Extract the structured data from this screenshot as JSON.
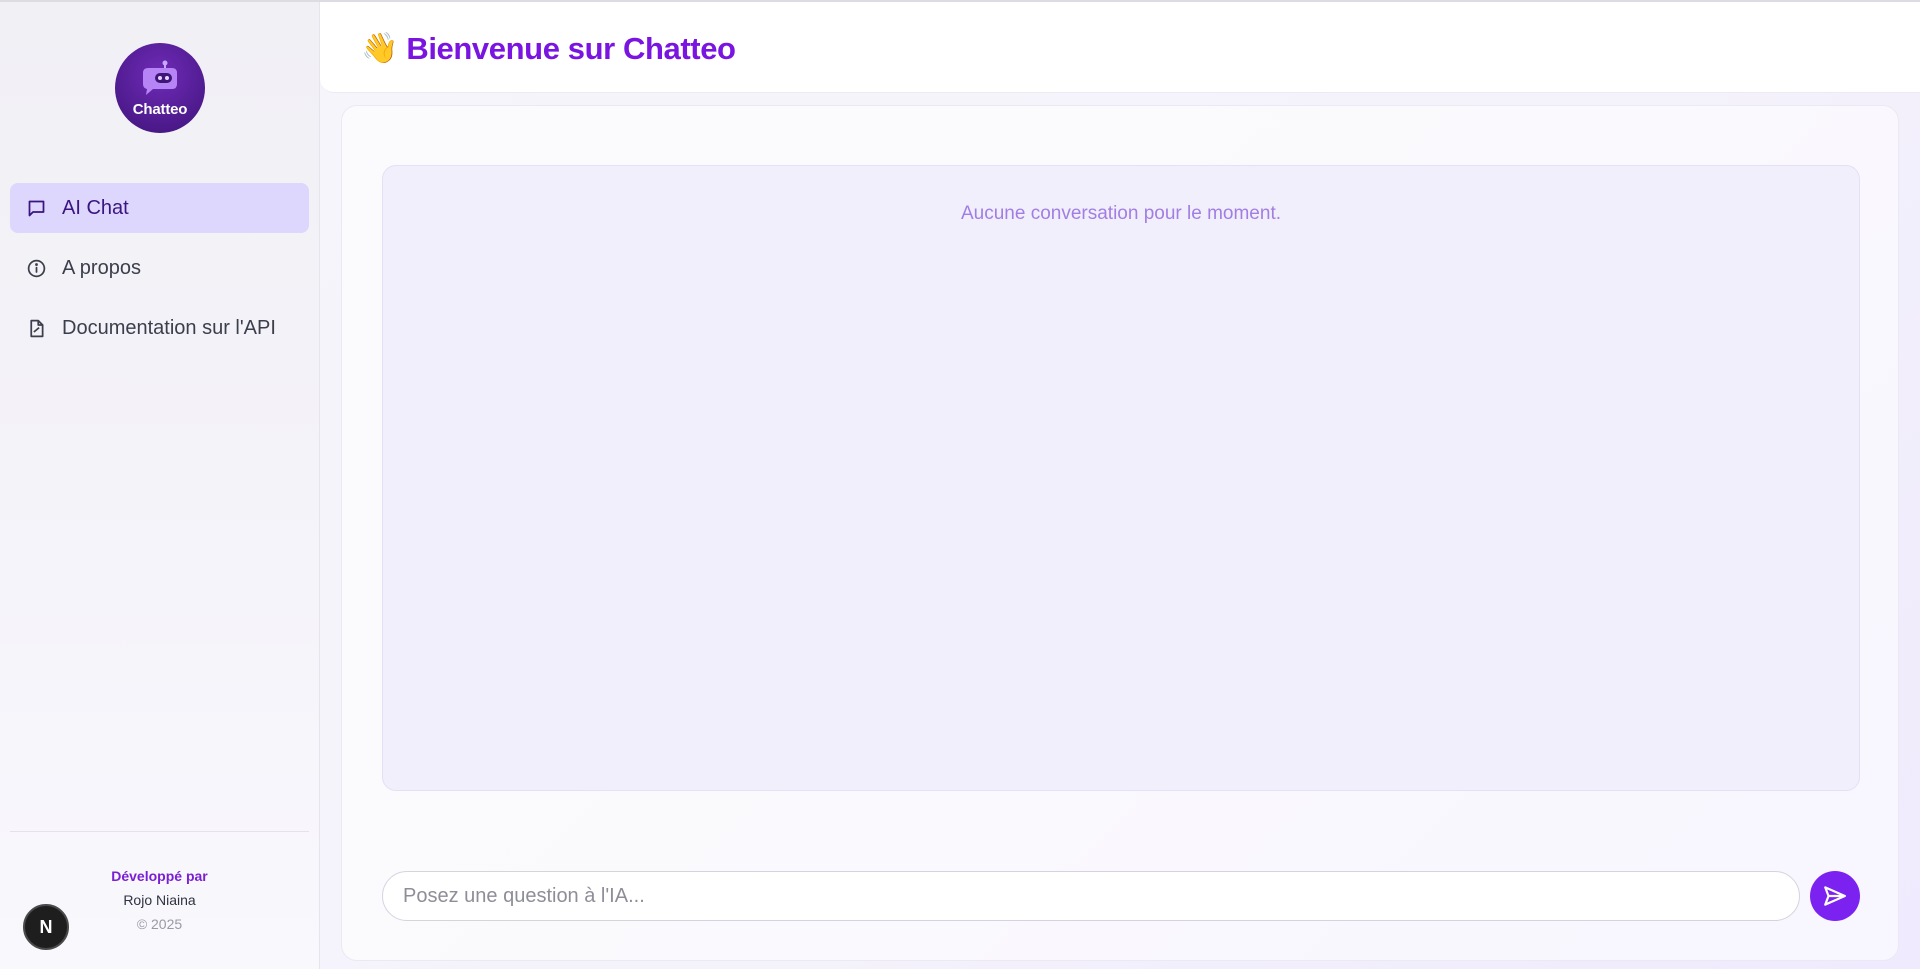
{
  "header": {
    "wave_emoji": "👋",
    "title": "Bienvenue sur Chatteo"
  },
  "sidebar": {
    "logo_text": "Chatteo",
    "items": [
      {
        "label": "AI Chat",
        "icon": "chat-bubble-icon",
        "active": true
      },
      {
        "label": "A propos",
        "icon": "info-icon",
        "active": false
      },
      {
        "label": "Documentation sur l'API",
        "icon": "document-icon",
        "active": false
      }
    ],
    "credit": {
      "developed_by": "Développé par",
      "name": "Rojo Niaina",
      "copyright": "© 2025"
    },
    "badge_letter": "N"
  },
  "chat": {
    "empty_message": "Aucune conversation pour le moment.",
    "input_placeholder": "Posez une question à l'IA...",
    "input_value": ""
  },
  "colors": {
    "brand": "#7a14e0",
    "active_nav_bg": "#ddd6fd",
    "send_button": "#7c22f0",
    "conversation_bg": "#f1effc"
  }
}
